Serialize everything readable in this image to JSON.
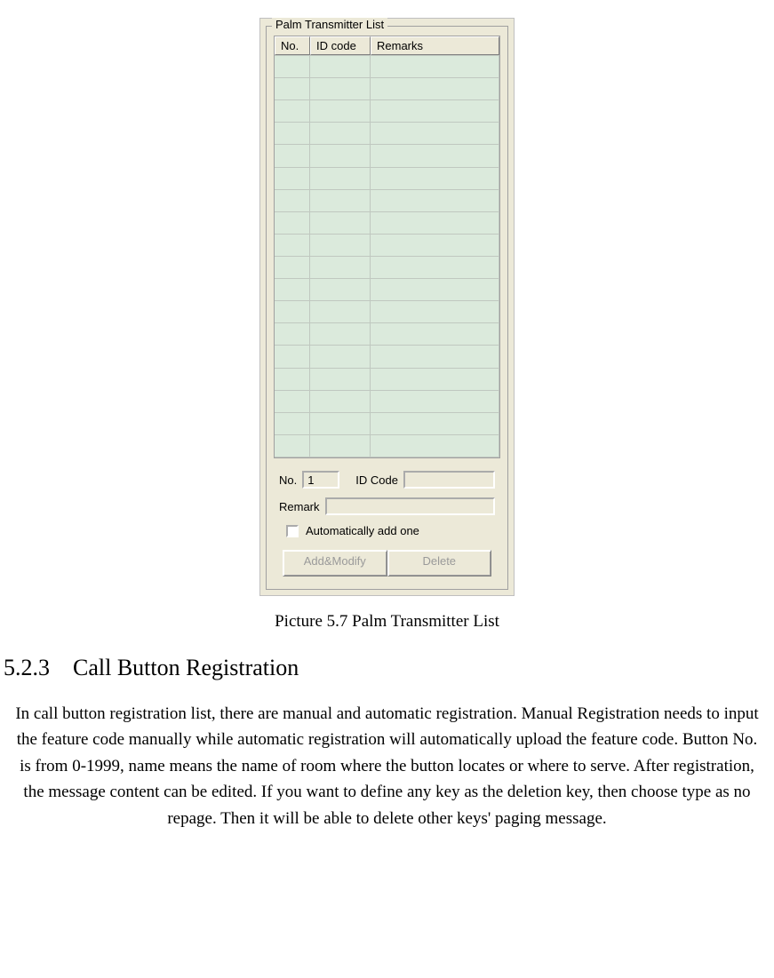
{
  "groupbox": {
    "title": "Palm Transmitter List"
  },
  "list": {
    "columns": {
      "no": "No.",
      "id": "ID code",
      "remarks": "Remarks"
    },
    "row_count": 18
  },
  "form": {
    "no_label": "No.",
    "no_value": "1",
    "idcode_label": "ID Code",
    "idcode_value": "",
    "remark_label": "Remark",
    "remark_value": "",
    "auto_add_label": "Automatically add one",
    "auto_add_checked": false
  },
  "buttons": {
    "add_modify": "Add&Modify",
    "delete": "Delete"
  },
  "caption": "Picture 5.7    Palm Transmitter List",
  "section": {
    "number": "5.2.3",
    "title": "Call Button Registration"
  },
  "paragraph": "In call button registration list, there are manual and automatic registration. Manual Registration needs to input the feature code manually while automatic registration will automatically upload the feature code. Button No. is from 0-1999, name means the name of room where the button locates or where to serve. After registration, the message content can be edited. If you want to define any key as the deletion key, then choose type as no repage. Then it will be able to delete other keys' paging message."
}
